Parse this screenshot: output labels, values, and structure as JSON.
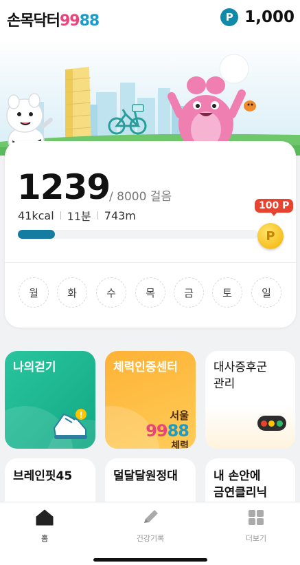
{
  "header": {
    "logo": {
      "text": "손목닥터",
      "num1": "99",
      "num2": "88"
    },
    "points": {
      "icon": "P",
      "value": "1,000"
    }
  },
  "steps": {
    "count": "1239",
    "goal": "/ 8000 걸음",
    "kcal": "41kcal",
    "minutes": "11분",
    "distance": "743m",
    "progress_fraction": 0.155,
    "coin_badge": "100 P",
    "coin_icon": "P",
    "days": [
      "월",
      "화",
      "수",
      "목",
      "금",
      "토",
      "일"
    ]
  },
  "tiles": {
    "my_walk": "나의걷기",
    "fitness_center": "체력인증센터",
    "seoul_logo": {
      "line1": "서울",
      "num1": "99",
      "num2": "88",
      "line3": "체력"
    },
    "metabolic": "대사증후군\n관리",
    "brain_fit": "브레인핏45",
    "dal_dal": "덜달달원정대",
    "quit_smoking": "내 손안에\n금연클리닉"
  },
  "bottom_nav": {
    "home": "홈",
    "health_log": "건강기록",
    "more": "더보기"
  },
  "colors": {
    "accent": "#137ca0",
    "pink": "#e9457a",
    "blue": "#1d9cc9",
    "green_tile": "#1fb892",
    "orange_tile": "#fdb236",
    "coin_badge": "#e8432e"
  },
  "icons": {
    "points": "p-coin-icon",
    "home": "home-icon",
    "health_log": "pencil-icon",
    "more": "grid-icon",
    "shoe": "sneaker-icon",
    "traffic": "traffic-light-icon"
  }
}
